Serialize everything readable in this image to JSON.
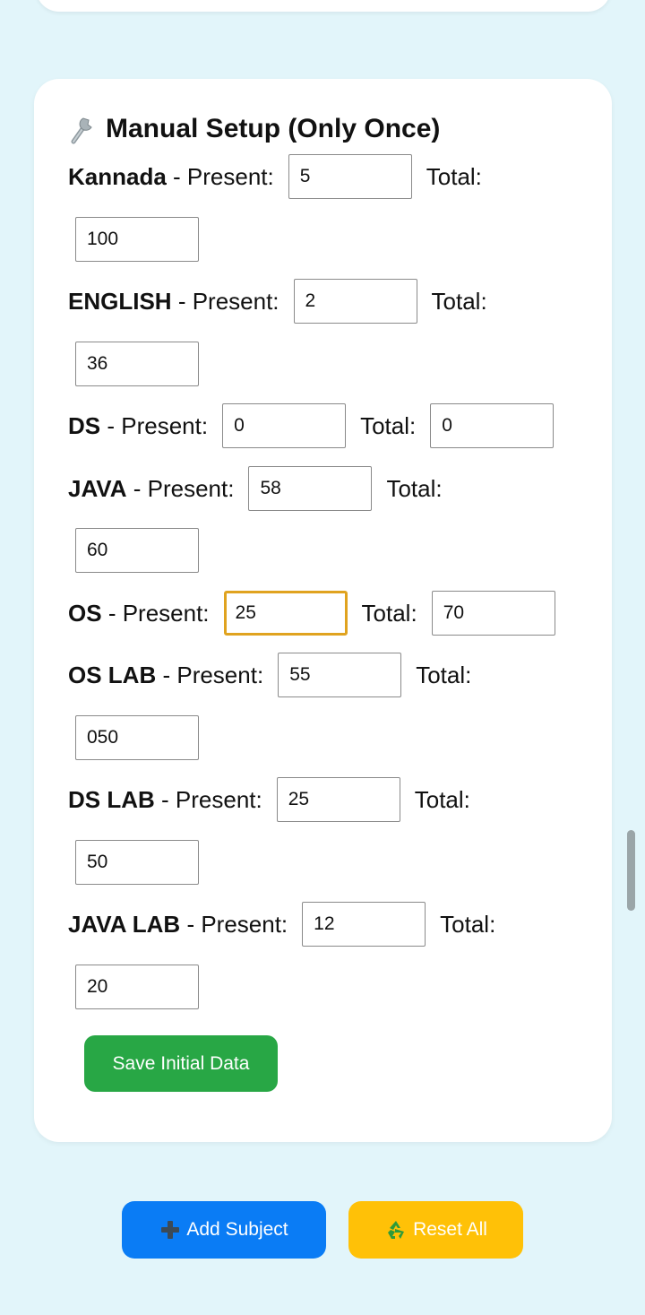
{
  "setup": {
    "title": "Manual Setup (Only Once)",
    "present_label": "- Present:",
    "total_label": "Total:",
    "subjects": [
      {
        "name": "Kannada",
        "present": "5",
        "total": "100"
      },
      {
        "name": "ENGLISH",
        "present": "2",
        "total": "36"
      },
      {
        "name": "DS",
        "present": "0",
        "total": "0"
      },
      {
        "name": "JAVA",
        "present": "58",
        "total": "60"
      },
      {
        "name": "OS",
        "present": "25",
        "total": "70"
      },
      {
        "name": "OS LAB",
        "present": "55",
        "total": "050"
      },
      {
        "name": "DS LAB",
        "present": "25",
        "total": "50"
      },
      {
        "name": "JAVA LAB",
        "present": "12",
        "total": "20"
      }
    ],
    "save_label": "Save Initial Data"
  },
  "actions": {
    "add_label": "Add Subject",
    "reset_label": "Reset All"
  },
  "icons": {
    "title": "wrench-icon",
    "add": "plus-icon",
    "reset": "recycle-icon"
  },
  "colors": {
    "background": "#e2f5fa",
    "save": "#28a745",
    "add": "#0a7cf5",
    "reset": "#ffc107",
    "focus": "#e0a31f"
  }
}
